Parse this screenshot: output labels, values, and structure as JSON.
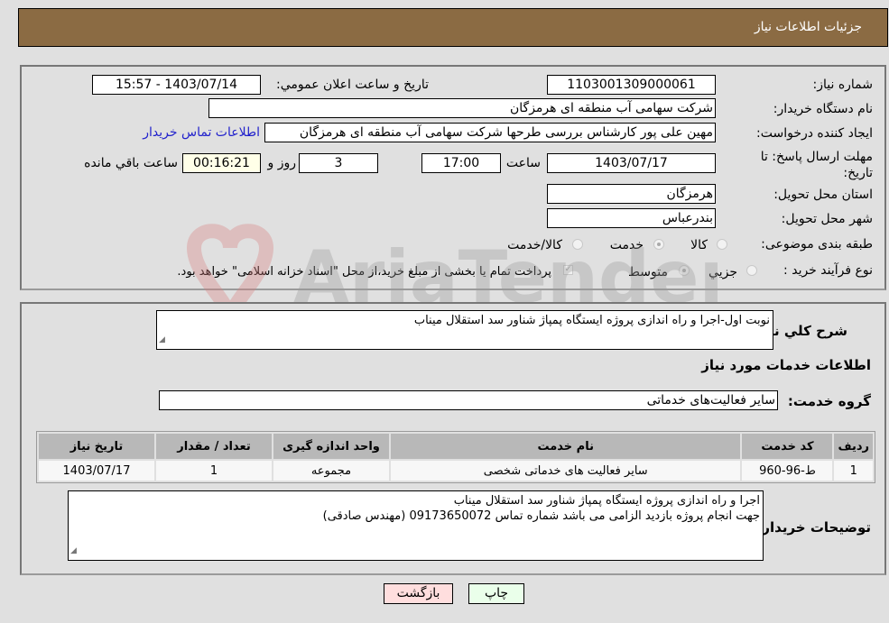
{
  "header": {
    "title": "جزئیات اطلاعات نیاز"
  },
  "form": {
    "need_number": {
      "label": "شماره نیاز:",
      "value": "1103001309000061"
    },
    "announce_datetime": {
      "label": "تاریخ و ساعت اعلان عمومي:",
      "value": "1403/07/14 - 15:57"
    },
    "buyer_org": {
      "label": "نام دستگاه خريدار:",
      "value": "شرکت سهامی  آب منطقه ای هرمزگان"
    },
    "creator": {
      "label": "ايجاد کننده درخواست:",
      "value": "مهین علی پور کارشناس بررسی طرحها شرکت سهامی  آب منطقه ای هرمزگان",
      "contact_link": "اطلاعات تماس خريدار"
    },
    "deadline": {
      "label": "مهلت ارسال پاسخ: تا تاریخ:",
      "date": "1403/07/17",
      "time_label": "ساعت",
      "time": "17:00",
      "days": "3",
      "days_label": "روز و",
      "remaining": "00:16:21",
      "remaining_label": "ساعت باقي مانده"
    },
    "province": {
      "label": "استان محل تحویل:",
      "value": "هرمزگان"
    },
    "city": {
      "label": "شهر محل تحویل:",
      "value": "بندرعباس"
    },
    "category": {
      "label": "طبقه بندی موضوعی:",
      "options": [
        {
          "label": "کالا",
          "selected": false
        },
        {
          "label": "خدمت",
          "selected": true
        },
        {
          "label": "کالا/خدمت",
          "selected": false
        }
      ]
    },
    "purchase_process": {
      "label": "نوع فرآيند خريد :",
      "options": [
        {
          "label": "جزيي",
          "selected": false
        },
        {
          "label": "متوسط",
          "selected": true
        }
      ],
      "treasury_note": "پرداخت تمام یا بخشی از مبلغ خرید،از محل \"اسناد خزانه اسلامی\" خواهد بود.",
      "treasury_checked": true
    }
  },
  "details": {
    "general_desc_label": "شرح کلي نياز:",
    "general_desc": "نوبت اول-اجرا و راه اندازی  پروژه  ایستگاه پمپاژ شناور سد استقلال میناب",
    "services_heading": "اطلاعات خدمات مورد نياز",
    "service_group_label": "گروه خدمت:",
    "service_group": "سایر فعالیت‌های خدماتی",
    "table": {
      "headers": [
        "رديف",
        "کد خدمت",
        "نام خدمت",
        "واحد اندازه گيری",
        "تعداد / مقدار",
        "تاريخ نياز"
      ],
      "rows": [
        [
          "1",
          "ط-96-960",
          "سایر فعالیت های خدماتی شخصی",
          "مجموعه",
          "1",
          "1403/07/17"
        ]
      ]
    },
    "buyer_notes_label": "توضيحات خريدار:",
    "buyer_notes_line1": "اجرا و راه اندازی  پروژه  ایستگاه پمپاژ شناور سد استقلال میناب",
    "buyer_notes_line2": "جهت انجام پروژه بازدید الزامی می باشد شماره تماس 09173650072 (مهندس صادقی)"
  },
  "buttons": {
    "print": "چاپ",
    "back": "بازگشت"
  },
  "watermark": {
    "text": "AriaTender.neT"
  },
  "colors": {
    "header_bg": "#8b6b43",
    "print_bg": "#eaffea",
    "back_bg": "#ffdede",
    "remaining_bg": "#ffffe8",
    "link": "#2222cc"
  }
}
